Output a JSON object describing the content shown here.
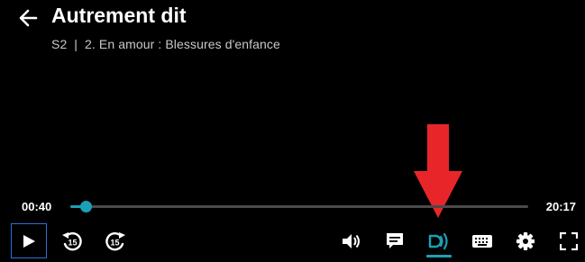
{
  "header": {
    "title": "Autrement dit",
    "subtitle": "S2  |  2. En amour : Blessures d'enfance"
  },
  "progress": {
    "current_time": "00:40",
    "duration": "20:17",
    "fraction": 0.033
  },
  "controls": {
    "play": "play-icon",
    "rewind": "rewind-15-icon",
    "forward": "forward-15-icon",
    "volume": "volume-icon",
    "subtitles": "subtitles-icon",
    "audio_description": "audio-description-icon",
    "keyboard": "keyboard-icon",
    "settings": "gear-icon",
    "fullscreen": "fullscreen-icon"
  },
  "colors": {
    "accent": "#1ba0b5",
    "annotation_arrow": "#e8262a",
    "focus": "#2d6fd6"
  }
}
